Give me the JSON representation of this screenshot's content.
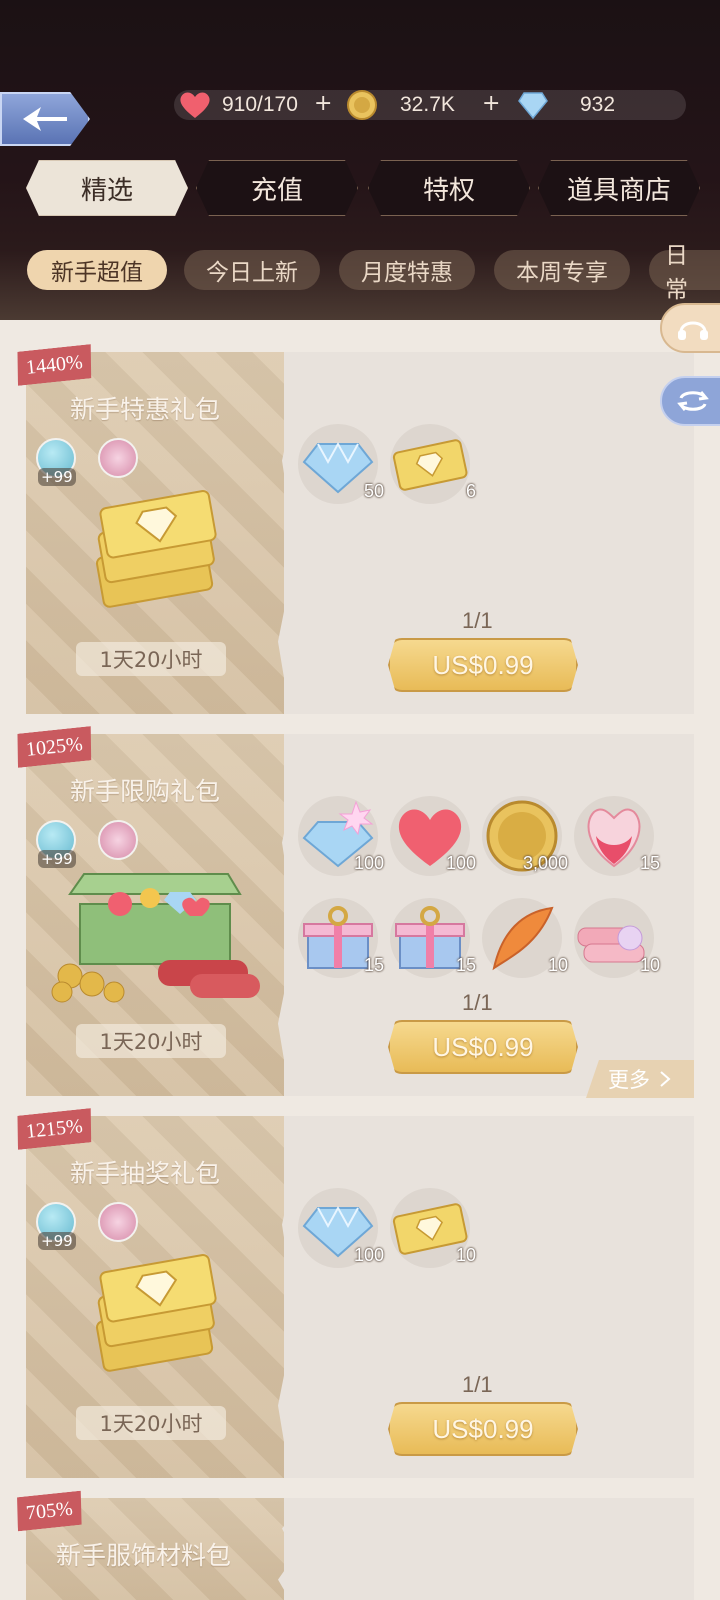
{
  "resources": {
    "stamina": "910/170",
    "gold": "32.7K",
    "diamonds": "932",
    "add_symbol": "+"
  },
  "tabs": [
    {
      "label": "精选",
      "active": true
    },
    {
      "label": "充值",
      "active": false
    },
    {
      "label": "特权",
      "active": false
    },
    {
      "label": "道具商店",
      "active": false
    }
  ],
  "subtabs": [
    {
      "label": "新手超值",
      "active": true
    },
    {
      "label": "今日上新",
      "active": false
    },
    {
      "label": "月度特惠",
      "active": false
    },
    {
      "label": "本周专享",
      "active": false
    },
    {
      "label": "日常",
      "active": false
    }
  ],
  "packs": [
    {
      "discount": "1440%",
      "title": "新手特惠礼包",
      "star_bonus": "+99",
      "timer": "1天20小时",
      "quota": "1/1",
      "price": "US$0.99",
      "items": [
        {
          "icon": "diamond-icon",
          "qty": "50"
        },
        {
          "icon": "gold-ticket-icon",
          "qty": "6"
        }
      ]
    },
    {
      "discount": "1025%",
      "title": "新手限购礼包",
      "star_bonus": "+99",
      "timer": "1天20小时",
      "quota": "1/1",
      "price": "US$0.99",
      "more": "更多",
      "items": [
        {
          "icon": "diamond-icon",
          "qty": "100"
        },
        {
          "icon": "heart-icon",
          "qty": "100"
        },
        {
          "icon": "gold-coin-icon",
          "qty": "3,000"
        },
        {
          "icon": "potion-icon",
          "qty": "15"
        },
        {
          "icon": "gift-box-icon",
          "qty": "15"
        },
        {
          "icon": "gift-box-icon",
          "qty": "15"
        },
        {
          "icon": "feather-icon",
          "qty": "10"
        },
        {
          "icon": "fabric-icon",
          "qty": "10"
        }
      ]
    },
    {
      "discount": "1215%",
      "title": "新手抽奖礼包",
      "star_bonus": "+99",
      "timer": "1天20小时",
      "quota": "1/1",
      "price": "US$0.99",
      "items": [
        {
          "icon": "diamond-icon",
          "qty": "100"
        },
        {
          "icon": "gold-ticket-icon",
          "qty": "10"
        }
      ]
    },
    {
      "discount": "705%",
      "title": "新手服饰材料包"
    }
  ]
}
